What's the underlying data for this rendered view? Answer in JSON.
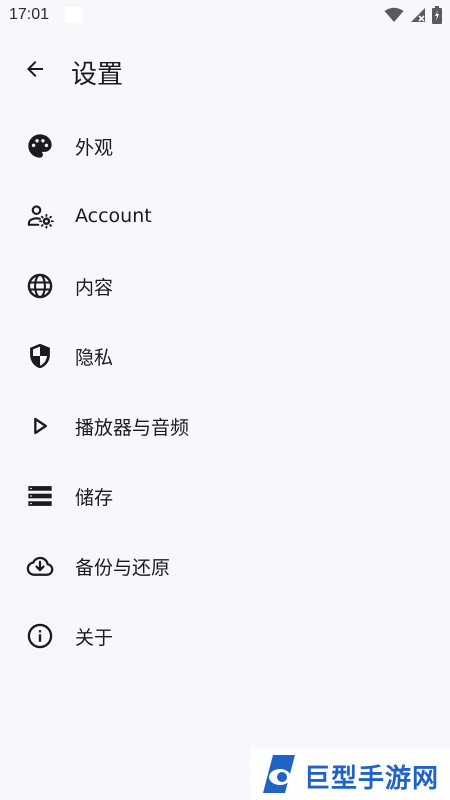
{
  "status_bar": {
    "time": "17:01",
    "icons": [
      "wifi-icon",
      "signal-icon",
      "battery-icon"
    ]
  },
  "toolbar": {
    "back_icon": "arrow-left-icon",
    "title": "设置"
  },
  "settings": {
    "items": [
      {
        "icon": "palette-icon",
        "label": "外观"
      },
      {
        "icon": "account-settings-icon",
        "label": "Account"
      },
      {
        "icon": "globe-icon",
        "label": "内容"
      },
      {
        "icon": "shield-icon",
        "label": "隐私"
      },
      {
        "icon": "play-icon",
        "label": "播放器与音频"
      },
      {
        "icon": "storage-icon",
        "label": "储存"
      },
      {
        "icon": "cloud-download-icon",
        "label": "备份与还原"
      },
      {
        "icon": "info-icon",
        "label": "关于"
      }
    ]
  },
  "watermark": {
    "text": "巨型手游网",
    "color": "#1f63c4"
  },
  "colors": {
    "background": "#f8f7fc",
    "text": "#1b1b1f"
  }
}
